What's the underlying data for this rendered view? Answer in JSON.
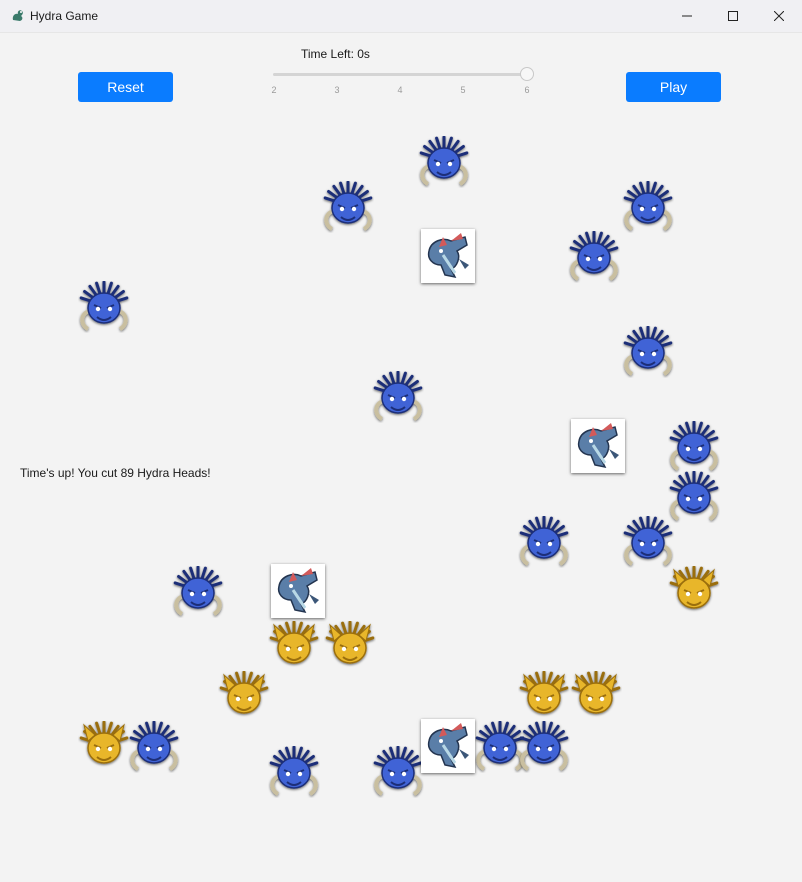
{
  "window": {
    "title": "Hydra Game",
    "minimize_icon": "minimize-icon",
    "maximize_icon": "maximize-icon",
    "close_icon": "close-icon"
  },
  "controls": {
    "reset_label": "Reset",
    "play_label": "Play",
    "time_label": "Time Left: 0s",
    "slider": {
      "min": 2,
      "max": 6,
      "value": 6,
      "ticks": [
        "2",
        "3",
        "4",
        "5",
        "6"
      ]
    }
  },
  "status_message": "Time's up! You cut 89 Hydra Heads!",
  "colors": {
    "button": "#0a7cff",
    "blue_head": "#3f63d6",
    "gold_head": "#e8b62a",
    "background": "#f3f3f3"
  },
  "board": {
    "heads": [
      {
        "type": "blue"
      },
      {
        "type": "blue"
      },
      {
        "type": "blue"
      },
      {
        "type": "blue"
      },
      {
        "type": "blue"
      },
      {
        "type": "blue"
      },
      {
        "type": "blue"
      },
      {
        "type": "blue"
      },
      {
        "type": "blue"
      },
      {
        "type": "blue"
      },
      {
        "type": "blue"
      },
      {
        "type": "blue"
      },
      {
        "type": "blue"
      },
      {
        "type": "gold"
      },
      {
        "type": "gold"
      },
      {
        "type": "gold"
      },
      {
        "type": "gold"
      },
      {
        "type": "gold"
      },
      {
        "type": "gold"
      },
      {
        "type": "gold"
      },
      {
        "type": "blue"
      },
      {
        "type": "blue"
      },
      {
        "type": "blue"
      },
      {
        "type": "blue"
      }
    ],
    "hydra_cards": [
      {
        "icon": "hydra-body-icon"
      },
      {
        "icon": "hydra-body-icon"
      },
      {
        "icon": "hydra-body-icon"
      },
      {
        "icon": "hydra-body-icon"
      }
    ]
  }
}
